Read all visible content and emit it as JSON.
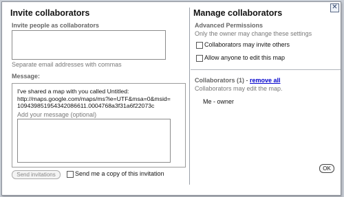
{
  "dialog": {
    "close_glyph": "✕",
    "ok_label": "OK"
  },
  "invite": {
    "title": "Invite collaborators",
    "emails_label": "Invite people as collaborators",
    "emails_value": "",
    "emails_hint": "Separate email addresses with commas",
    "message_label": "Message:",
    "message_line1": "I've shared a map with you called Untitled:",
    "message_line2": "http://maps.google.com/maps/ms?ie=UTF&msa=0&msid=",
    "message_line3": "109439851954342086611.0004768a3f31a6f22073c",
    "add_message_label": "Add your message (optional)",
    "add_message_value": "",
    "send_label": "Send invitations",
    "copy_label": "Send me a copy of this invitation",
    "copy_checked": false
  },
  "manage": {
    "title": "Manage collaborators",
    "advanced_label": "Advanced Permissions",
    "owner_note": "Only the owner may change these settings",
    "may_invite_label": "Collaborators may invite others",
    "may_invite_checked": false,
    "anyone_edit_label": "Allow anyone to edit this map",
    "anyone_edit_checked": false,
    "collaborators_heading": "Collaborators (1) - ",
    "remove_all_label": "remove all",
    "may_edit_note": "Collaborators may edit the map.",
    "members": [
      "Me - owner"
    ]
  },
  "colors": {
    "link": "#0000cc",
    "muted_text": "#777777",
    "divider": "#9aa0a8"
  }
}
